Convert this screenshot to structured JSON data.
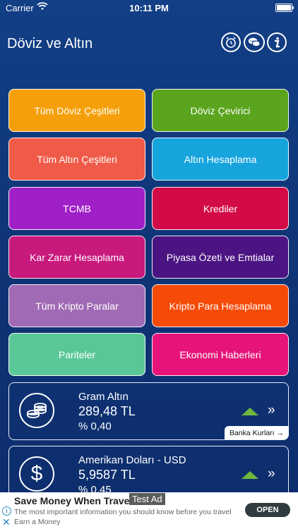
{
  "status_bar": {
    "carrier": "Carrier",
    "time": "10:11 PM"
  },
  "header": {
    "title": "Döviz ve Altın",
    "icons": [
      "alarm-icon",
      "chat-bubbles-icon",
      "info-icon"
    ]
  },
  "menu": [
    {
      "label": "Tüm Döviz Çeşitleri",
      "color": "#f5a00a"
    },
    {
      "label": "Döviz Çevirici",
      "color": "#5aa41e"
    },
    {
      "label": "Tüm Altın Çeşitleri",
      "color": "#f05a48"
    },
    {
      "label": "Altın Hesaplama",
      "color": "#16a4dc"
    },
    {
      "label": "TCMB",
      "color": "#a020c8"
    },
    {
      "label": "Krediler",
      "color": "#d20a46"
    },
    {
      "label": "Kar Zarar Hesaplama",
      "color": "#c8197d"
    },
    {
      "label": "Piyasa Özeti ve Emtialar",
      "color": "#4b1482"
    },
    {
      "label": "Tüm Kripto Paralar",
      "color": "#a06ab4"
    },
    {
      "label": "Kripto Para Hesaplama",
      "color": "#f54a08"
    },
    {
      "label": "Pariteler",
      "color": "#5ac896"
    },
    {
      "label": "Ekonomi Haberleri",
      "color": "#e61478"
    }
  ],
  "cards": [
    {
      "name": "Gram Altın",
      "value": "289,48 TL",
      "change": "% 0,40",
      "trend": "up",
      "icon": "coins-icon",
      "bank_button": "Banka Kurları →"
    },
    {
      "name": "Amerikan Doları - USD",
      "value": "5,9587 TL",
      "change": "% 0,45",
      "trend": "up",
      "icon": "dollar-icon"
    }
  ],
  "ad": {
    "title": "Save Money When Travel",
    "label": "Test Ad",
    "body": "The most important information you should know before you travel",
    "brand": "Earn a Money",
    "cta": "OPEN"
  }
}
